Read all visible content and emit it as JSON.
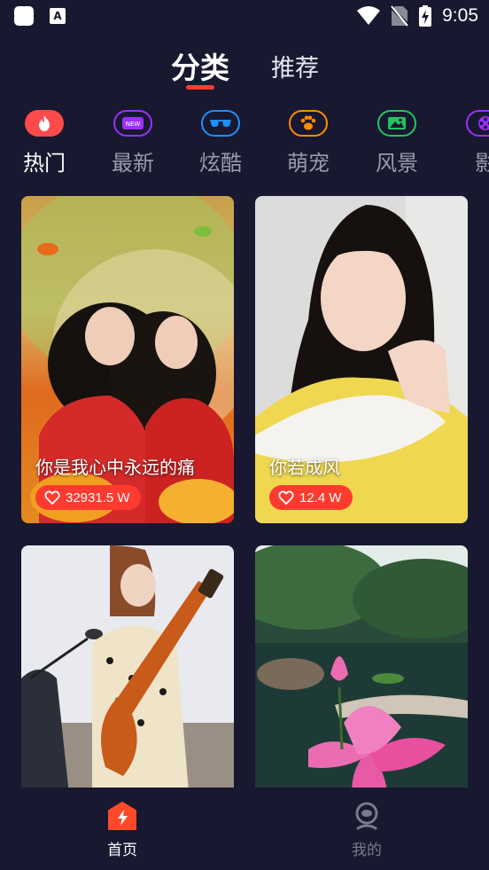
{
  "status_bar": {
    "time": "9:05",
    "app_badge": "A",
    "icons": [
      "app-square-icon",
      "a-notification-icon",
      "wifi-icon",
      "no-sim-icon",
      "battery-charging-icon"
    ]
  },
  "top_tabs": [
    {
      "label": "分类",
      "active": true
    },
    {
      "label": "推荐",
      "active": false
    }
  ],
  "categories": [
    {
      "label": "热门",
      "icon": "fire-icon",
      "active": true,
      "color": "#ff4444"
    },
    {
      "label": "最新",
      "icon": "new-badge-icon",
      "active": false,
      "color": "#9b30ff"
    },
    {
      "label": "炫酷",
      "icon": "sunglasses-icon",
      "active": false,
      "color": "#1e90ff"
    },
    {
      "label": "萌宠",
      "icon": "paw-icon",
      "active": false,
      "color": "#ff8c00"
    },
    {
      "label": "风景",
      "icon": "landscape-icon",
      "active": false,
      "color": "#22c55e"
    },
    {
      "label": "影",
      "icon": "film-reel-icon",
      "active": false,
      "color": "#9b30ff"
    }
  ],
  "videos": [
    {
      "title": "你是我心中永远的痛",
      "likes": "32931.5 W"
    },
    {
      "title": "你若成风",
      "likes": "12.4 W"
    },
    {
      "title": "",
      "likes": ""
    },
    {
      "title": "",
      "likes": ""
    }
  ],
  "bottom_nav": [
    {
      "label": "首页",
      "icon": "home-bolt-icon",
      "active": true
    },
    {
      "label": "我的",
      "icon": "profile-icon",
      "active": false
    }
  ],
  "colors": {
    "background": "#181830",
    "accent": "#ff3b30",
    "inactive_text": "#9a9aaa"
  }
}
